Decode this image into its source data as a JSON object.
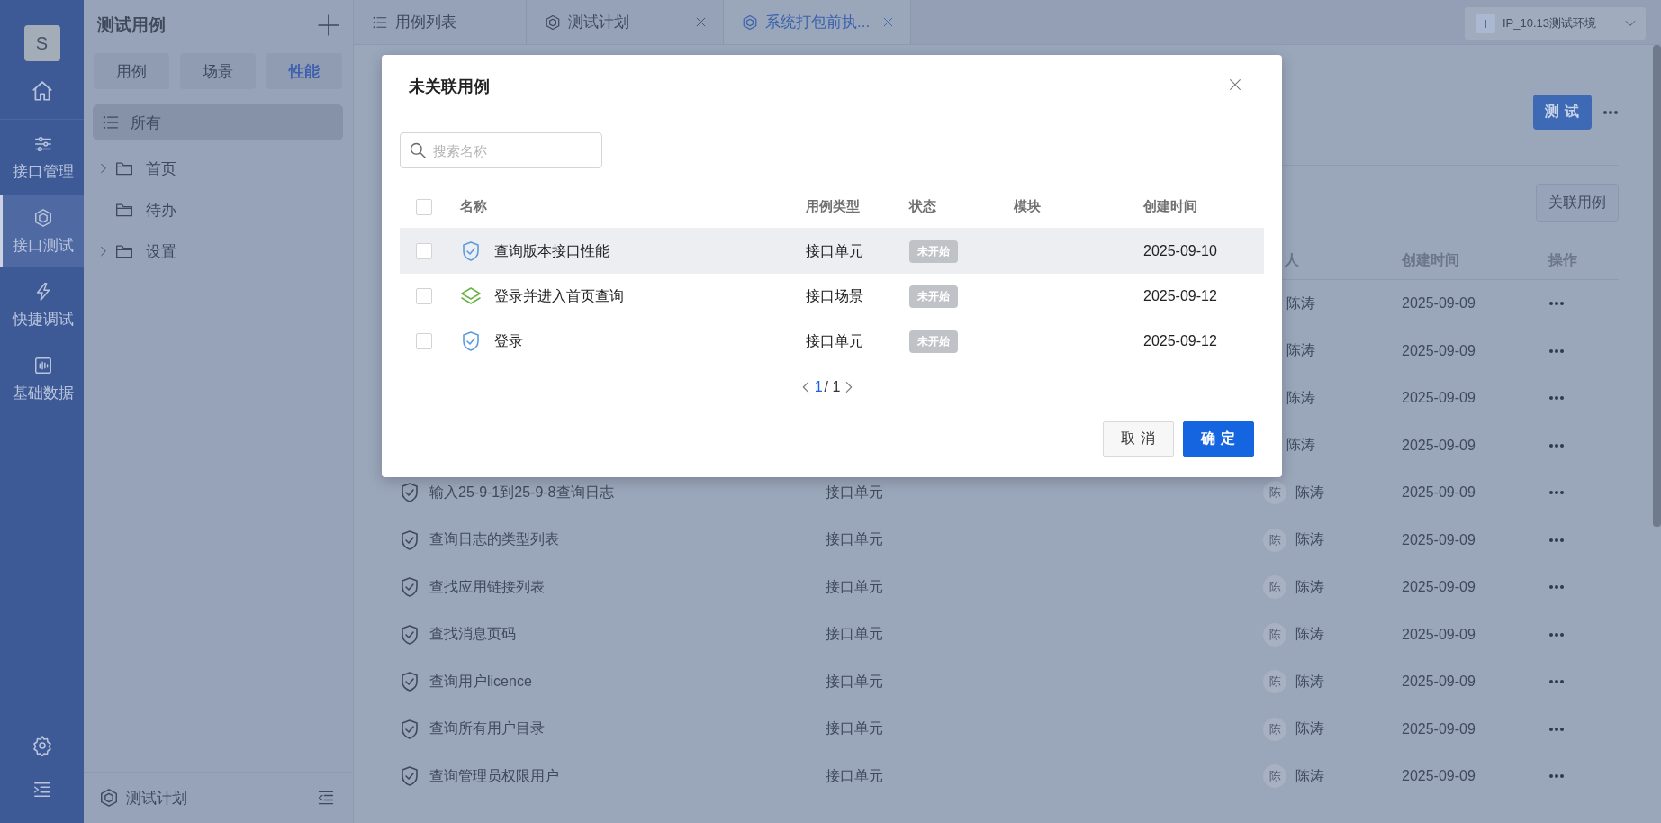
{
  "nav": {
    "avatar": "S",
    "items": [
      {
        "label": "接口管理",
        "selected": false
      },
      {
        "label": "接口测试",
        "selected": true
      },
      {
        "label": "快捷调试",
        "selected": false
      },
      {
        "label": "基础数据",
        "selected": false
      }
    ]
  },
  "sidebar": {
    "title": "测试用例",
    "segments": [
      {
        "label": "用例",
        "selected": false
      },
      {
        "label": "场景",
        "selected": false
      },
      {
        "label": "性能",
        "selected": true
      }
    ],
    "all": {
      "label": "所有",
      "selected": true
    },
    "tree": [
      {
        "label": "首页",
        "expandable": true
      },
      {
        "label": "待办",
        "expandable": false
      },
      {
        "label": "设置",
        "expandable": true
      }
    ],
    "footer": "测试计划"
  },
  "tabs": [
    {
      "label": "用例列表",
      "closable": false,
      "selected": false
    },
    {
      "label": "测试计划",
      "closable": true,
      "selected": false
    },
    {
      "label": "系统打包前执...",
      "closable": true,
      "selected": true
    }
  ],
  "environment": {
    "badge": "I",
    "label": "IP_10.13测试环境"
  },
  "toolbar": {
    "test_button": "测 试",
    "link_button": "关联用例"
  },
  "table": {
    "columns": [
      "人",
      "创建时间",
      "操作"
    ],
    "rows": [
      {
        "person": "陈涛",
        "date": "2025-09-09"
      },
      {
        "person": "陈涛",
        "date": "2025-09-09"
      },
      {
        "person": "陈涛",
        "date": "2025-09-09"
      },
      {
        "person": "陈涛",
        "date": "2025-09-09"
      },
      {
        "name": "输入25-9-1到25-9-8查询日志",
        "type": "接口单元",
        "avatar": "陈",
        "person": "陈涛",
        "date": "2025-09-09"
      },
      {
        "name": "查询日志的类型列表",
        "type": "接口单元",
        "avatar": "陈",
        "person": "陈涛",
        "date": "2025-09-09"
      },
      {
        "name": "查找应用链接列表",
        "type": "接口单元",
        "avatar": "陈",
        "person": "陈涛",
        "date": "2025-09-09"
      },
      {
        "name": "查找消息页码",
        "type": "接口单元",
        "avatar": "陈",
        "person": "陈涛",
        "date": "2025-09-09"
      },
      {
        "name": "查询用户licence",
        "type": "接口单元",
        "avatar": "陈",
        "person": "陈涛",
        "date": "2025-09-09"
      },
      {
        "name": "查询所有用户目录",
        "type": "接口单元",
        "avatar": "陈",
        "person": "陈涛",
        "date": "2025-09-09"
      },
      {
        "name": "查询管理员权限用户",
        "type": "接口单元",
        "avatar": "陈",
        "person": "陈涛",
        "date": "2025-09-09"
      }
    ]
  },
  "dialog": {
    "title": "未关联用例",
    "search": {
      "placeholder": "搜索名称"
    },
    "select_all_checked": false,
    "columns": [
      "名称",
      "用例类型",
      "状态",
      "模块",
      "创建时间"
    ],
    "rows": [
      {
        "kind": "unit",
        "name": "查询版本接口性能",
        "type": "接口单元",
        "status": "未开始",
        "date": "2025-09-10",
        "checked": false,
        "highlighted": true
      },
      {
        "kind": "scene",
        "name": "登录并进入首页查询",
        "type": "接口场景",
        "status": "未开始",
        "date": "2025-09-12",
        "checked": false,
        "highlighted": false
      },
      {
        "kind": "unit",
        "name": "登录",
        "type": "接口单元",
        "status": "未开始",
        "date": "2025-09-12",
        "checked": false,
        "highlighted": false
      }
    ],
    "pagination": {
      "current": "1",
      "total": "/ 1"
    },
    "buttons": [
      {
        "label": "取 消",
        "kind": "secondary"
      },
      {
        "label": "确 定",
        "kind": "primary"
      }
    ]
  }
}
